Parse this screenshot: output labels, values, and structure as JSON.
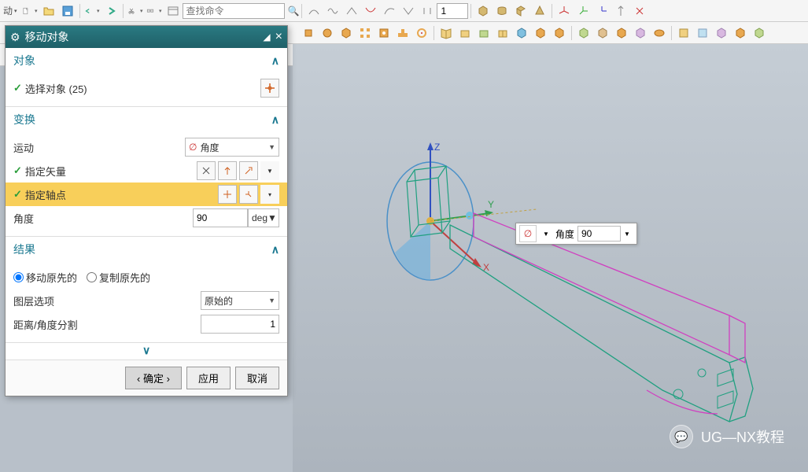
{
  "toolbar": {
    "left_label": "动",
    "search_placeholder": "查找命令",
    "num_value": "1"
  },
  "dialog": {
    "title": "移动对象",
    "sections": {
      "object": {
        "title": "对象",
        "select_label": "选择对象 (25)"
      },
      "transform": {
        "title": "变换",
        "motion_label": "运动",
        "motion_value": "角度",
        "vector_label": "指定矢量",
        "pivot_label": "指定轴点",
        "angle_label": "角度",
        "angle_value": "90",
        "angle_unit": "deg"
      },
      "result": {
        "title": "结果",
        "move_label": "移动原先的",
        "copy_label": "复制原先的",
        "layer_label": "图层选项",
        "layer_value": "原始的",
        "div_label": "距离/角度分割",
        "div_value": "1"
      }
    },
    "buttons": {
      "ok": "确定",
      "apply": "应用",
      "cancel": "取消"
    }
  },
  "widget": {
    "label": "角度",
    "value": "90"
  },
  "watermark": "UG—NX教程",
  "axes": {
    "x": "X",
    "y": "Y",
    "z": "Z"
  }
}
